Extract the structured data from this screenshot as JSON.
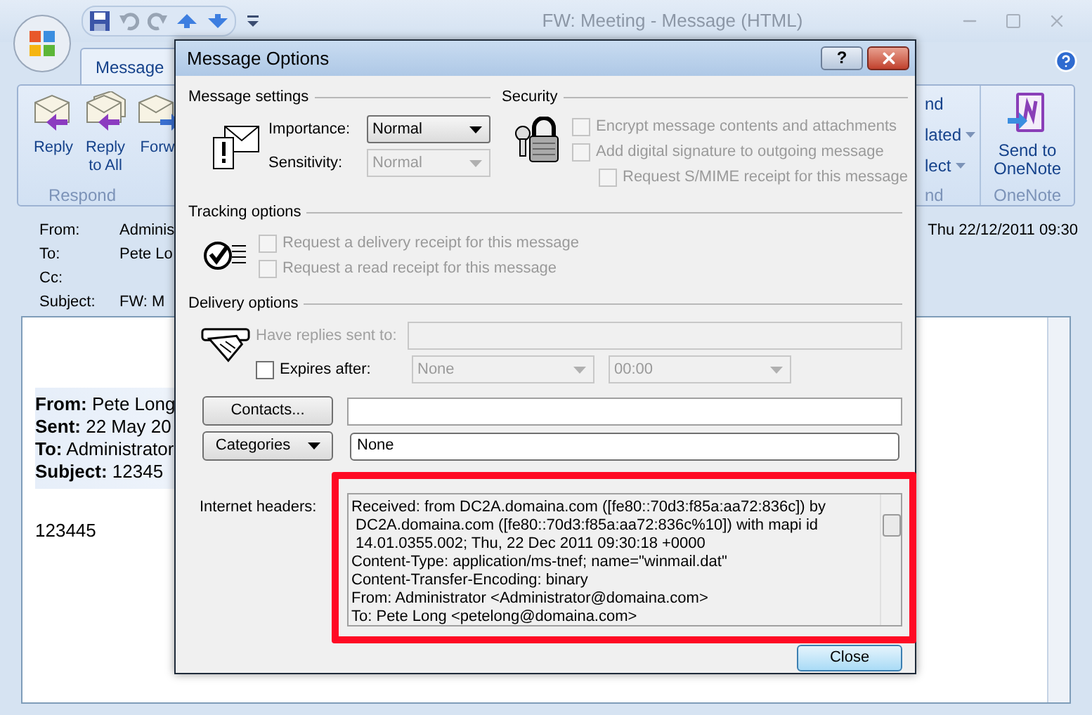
{
  "window": {
    "title": "FW: Meeting - Message (HTML)"
  },
  "tabs": [
    {
      "label": "Message",
      "selected": true
    }
  ],
  "ribbon": {
    "respond": {
      "buttons": [
        {
          "label": "Reply",
          "kind": "reply"
        },
        {
          "label": "Reply to All",
          "kind": "replyall"
        },
        {
          "label": "Forw",
          "kind": "forward"
        }
      ],
      "label": "Respond"
    },
    "find": {
      "items": [
        {
          "label": "nd",
          "dropdown": false
        },
        {
          "label": "lated",
          "dropdown": true
        },
        {
          "label": "lect",
          "dropdown": true
        }
      ],
      "label": "nd"
    },
    "onenote": {
      "button": "Send to OneNote",
      "label": "OneNote"
    }
  },
  "header_fields": [
    {
      "label": "From:",
      "value": "Adminis"
    },
    {
      "label": "To:",
      "value": "Pete Lo"
    },
    {
      "label": "Cc:"
    },
    {
      "label": "Subject:",
      "value": "FW: M"
    }
  ],
  "sent_time": "Thu 22/12/2011 09:30",
  "body": {
    "forward_header": [
      "**From:** Pete Long",
      "**Sent:** 22 May 20",
      "**To:** Administrator",
      "**Subject:** 12345"
    ],
    "text": "123445"
  },
  "dialog": {
    "title": "Message Options",
    "help_button": "?",
    "message_settings": {
      "heading": "Message settings",
      "importance": {
        "label": "Importance:",
        "value": "Normal",
        "disabled": false
      },
      "sensitivity": {
        "label": "Sensitivity:",
        "value": "Normal",
        "disabled": true
      }
    },
    "security": {
      "heading": "Security",
      "options": [
        {
          "label": "Encrypt message contents and attachments",
          "checked": false,
          "disabled": true,
          "indented": false
        },
        {
          "label": "Add digital signature to outgoing message",
          "checked": false,
          "disabled": true,
          "indented": false
        },
        {
          "label": "Request S/MIME receipt for this message",
          "checked": false,
          "disabled": true,
          "indented": true
        }
      ]
    },
    "tracking": {
      "heading": "Tracking options",
      "options": [
        {
          "label": "Request a delivery receipt for this message",
          "checked": false,
          "disabled": true
        },
        {
          "label": "Request a read receipt for this message",
          "checked": false,
          "disabled": true
        }
      ]
    },
    "delivery": {
      "heading": "Delivery options",
      "replies_to": {
        "label": "Have replies sent to:",
        "disabled": true
      },
      "expires": {
        "label": "Expires after:",
        "checked": false,
        "disabled": false,
        "date": "None",
        "time": "00:00"
      }
    },
    "contacts": {
      "button": "Contacts..."
    },
    "categories": {
      "button": "Categories",
      "value": "None"
    },
    "internet_headers": {
      "label": "Internet headers:",
      "lines": [
        "Received: from DC2A.domaina.com ([fe80::70d3:f85a:aa72:836c]) by",
        " DC2A.domaina.com ([fe80::70d3:f85a:aa72:836c%10]) with mapi id",
        " 14.01.0355.002; Thu, 22 Dec 2011 09:30:18 +0000",
        "Content-Type: application/ms-tnef; name=\"winmail.dat\"",
        "Content-Transfer-Encoding: binary",
        "From: Administrator <Administrator@domaina.com>",
        "To: Pete Long <petelong@domaina.com>"
      ]
    },
    "close_button": "Close"
  }
}
